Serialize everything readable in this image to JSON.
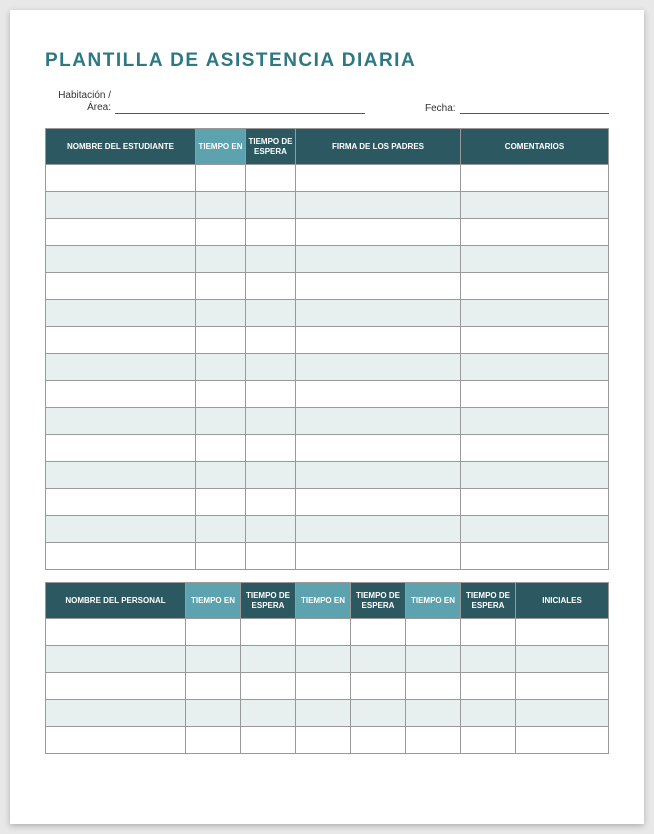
{
  "title": "PLANTILLA DE ASISTENCIA DIARIA",
  "meta": {
    "room_label_line1": "Habitación /",
    "room_label_line2": "Área:",
    "room_value": "",
    "date_label": "Fecha:",
    "date_value": ""
  },
  "table1": {
    "headers": {
      "name": "NOMBRE DEL ESTUDIANTE",
      "time_in": "TIEMPO EN",
      "time_out": "TIEMPO DE ESPERA",
      "signature": "FIRMA DE LOS PADRES",
      "comments": "COMENTARIOS"
    },
    "row_count": 15
  },
  "table2": {
    "headers": {
      "name": "NOMBRE DEL PERSONAL",
      "time_in": "TIEMPO EN",
      "time_out": "TIEMPO DE ESPERA",
      "initials": "INICIALES"
    },
    "row_count": 5
  }
}
